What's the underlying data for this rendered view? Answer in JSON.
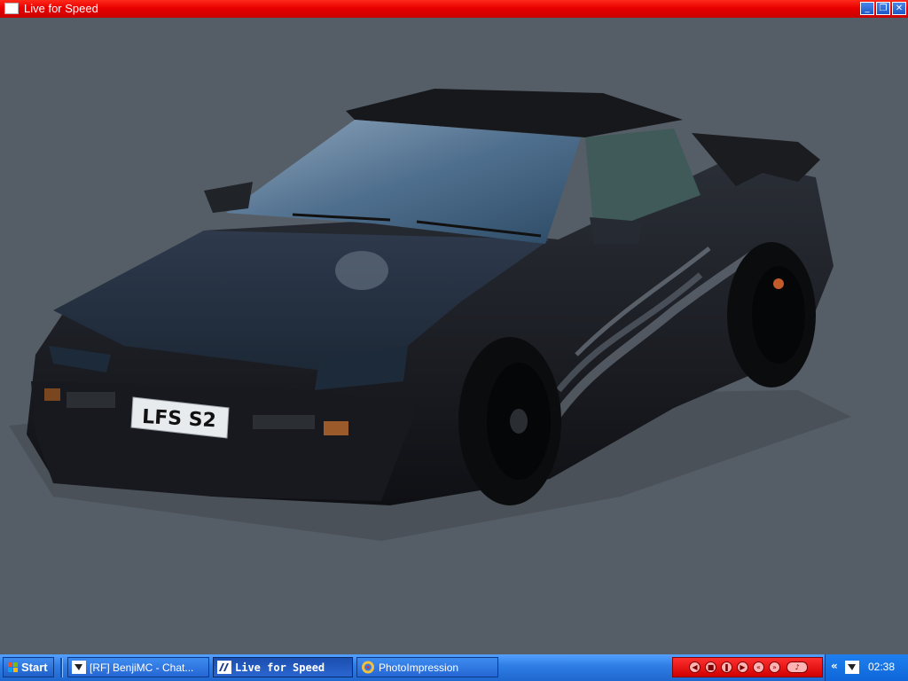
{
  "window": {
    "title": "Live for Speed",
    "controls": [
      "minimize",
      "restore",
      "close"
    ]
  },
  "scene": {
    "plate_text": "LFS S2",
    "body_color": "#1b1d22",
    "background_color": "#555d66"
  },
  "taskbar": {
    "start_label": "Start",
    "tasks": [
      {
        "label": "[RF] BenjiMC - Chat...",
        "icon": "chat-app-icon",
        "active": false
      },
      {
        "label": "Live for Speed",
        "icon": "lfs-app-icon",
        "active": true
      },
      {
        "label": "PhotoImpression",
        "icon": "photoimpression-app-icon",
        "active": false
      }
    ],
    "clock": "02:38",
    "tray_expand_label": "«"
  },
  "colors": {
    "titlebar": "#e80000",
    "taskbar": "#2f7fe6",
    "media_bar": "#d00000"
  }
}
